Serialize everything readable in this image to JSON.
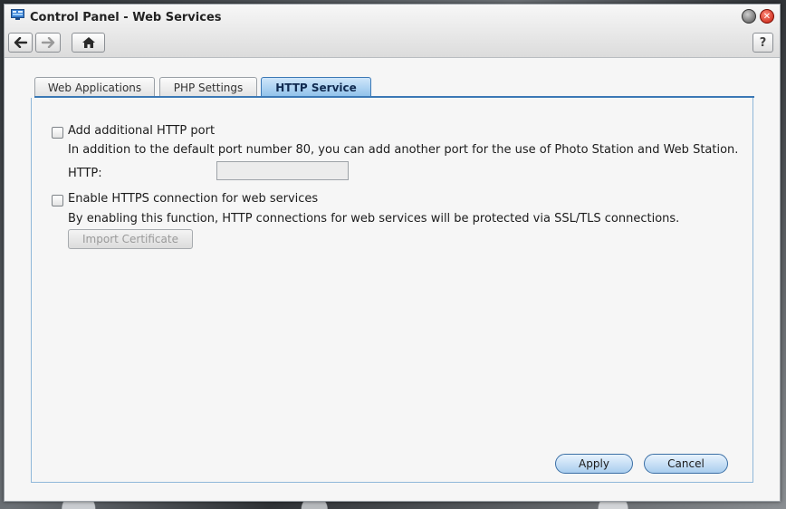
{
  "window": {
    "title": "Control Panel - Web Services",
    "help_label": "?",
    "close_glyph": "✕"
  },
  "icons": {
    "app": "control-panel-icon",
    "back": "arrow-left-icon",
    "forward": "arrow-right-icon",
    "home": "home-icon"
  },
  "tabs": [
    {
      "label": "Web Applications",
      "active": false
    },
    {
      "label": "PHP Settings",
      "active": false
    },
    {
      "label": "HTTP Service",
      "active": true
    }
  ],
  "http_port": {
    "checkbox_label": "Add additional HTTP port",
    "description": "In addition to the default port number 80, you can add another port for the use of Photo Station and Web Station.",
    "field_label": "HTTP:",
    "field_value": "",
    "checked": false
  },
  "https": {
    "checkbox_label": "Enable HTTPS connection for web services",
    "description": "By enabling this function, HTTP connections for web services will be protected via SSL/TLS connections.",
    "checked": false,
    "import_button": "Import Certificate"
  },
  "footer": {
    "apply": "Apply",
    "cancel": "Cancel"
  },
  "colors": {
    "accent": "#3b78b5",
    "active_tab": "#8fc1ea",
    "close": "#c21808"
  }
}
